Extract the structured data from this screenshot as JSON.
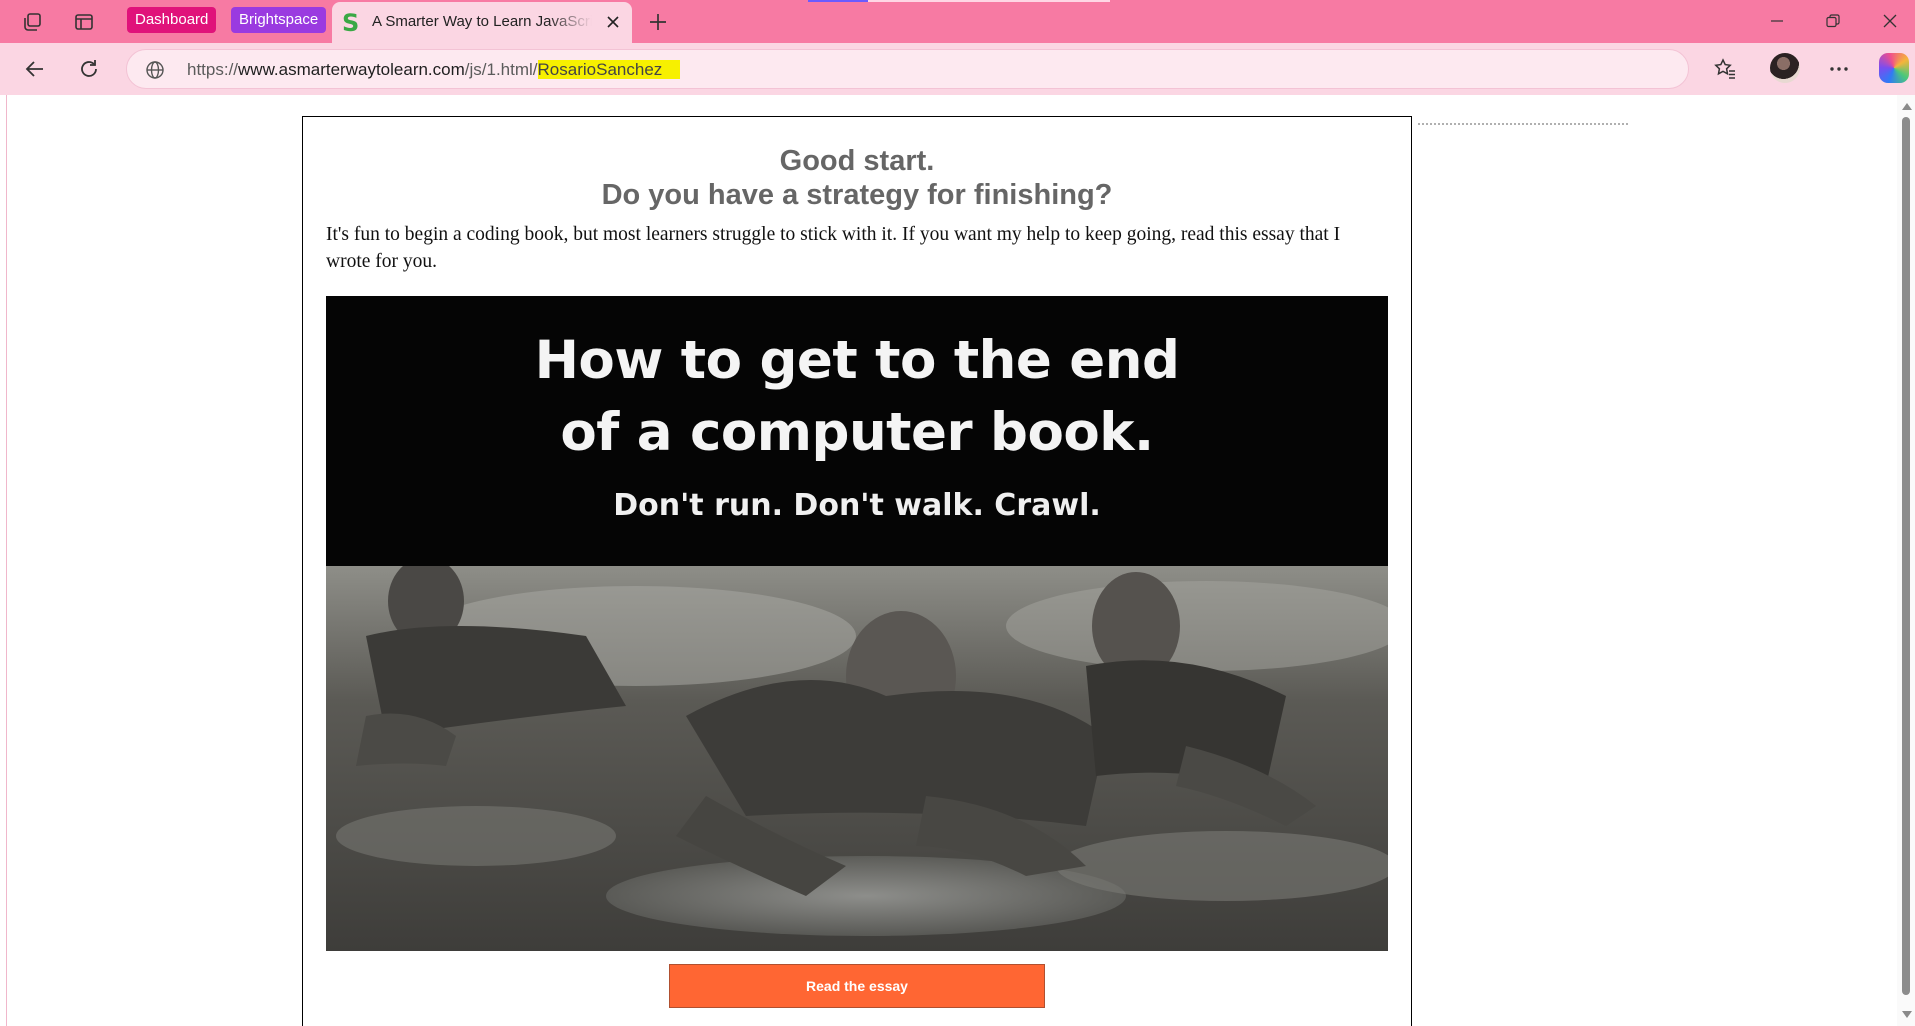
{
  "browser": {
    "tabs": {
      "dashboard_label": "Dashboard",
      "brightspace_label": "Brightspace",
      "active_tab_title": "A Smarter Way to Learn JavaScript",
      "active_tab_favicon": "S"
    },
    "address_bar": {
      "url_scheme": "https://",
      "url_host": "www.asmarterwaytolearn.com",
      "url_path": "/js/1.html/",
      "url_highlight": "RosarioSanchez"
    },
    "colors": {
      "tabstrip": "#f77aa3",
      "toolbar": "#fbd6e3",
      "highlight": "#f7f000"
    }
  },
  "page": {
    "heading_line1": "Good start.",
    "heading_line2": "Do you have a strategy for finishing?",
    "body": "It's fun to begin a coding book, but most learners struggle to stick with it. If you want my help to keep going, read this essay that I wrote for you.",
    "hero": {
      "title_line1": "How to get to the end",
      "title_line2": "of a computer book.",
      "subtitle": "Don't run. Don't walk. Crawl."
    },
    "cta_label": "Read the essay",
    "cta_color": "#ff6633"
  },
  "icons": {
    "workspaces": "workspaces-icon",
    "tab_actions": "tab-actions-icon",
    "new_tab": "plus-icon",
    "close_tab": "close-icon",
    "minimize": "minimize-icon",
    "restore": "restore-icon",
    "close_window": "close-window-icon",
    "back": "back-arrow-icon",
    "refresh": "refresh-icon",
    "site_info": "globe-icon",
    "favorites": "favorites-icon",
    "more": "more-icon",
    "copilot": "copilot-icon"
  }
}
